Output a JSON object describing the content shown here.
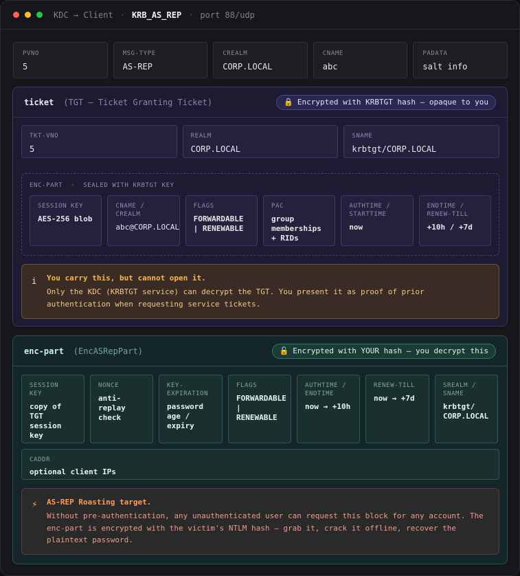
{
  "titlebar": {
    "route": "KDC → Client",
    "message": "KRB_AS_REP",
    "port": "port 88/udp"
  },
  "header_fields": [
    {
      "label": "PVNO",
      "value": "5"
    },
    {
      "label": "MSG-TYPE",
      "value": "AS-REP"
    },
    {
      "label": "CREALM",
      "value": "CORP.LOCAL"
    },
    {
      "label": "CNAME",
      "value": "abc"
    },
    {
      "label": "PADATA",
      "value": "salt info"
    }
  ],
  "ticket": {
    "title": "ticket",
    "subtitle": "(TGT — Ticket Granting Ticket)",
    "badge": "Encrypted with KRBTGT hash — opaque to you",
    "badge_icon": "lock-icon",
    "fields": [
      {
        "label": "TKT-VNO",
        "value": "5"
      },
      {
        "label": "REALM",
        "value": "CORP.LOCAL"
      },
      {
        "label": "SNAME",
        "value": "krbtgt/CORP.LOCAL"
      }
    ],
    "enc_part_label": "ENC-PART  ·  SEALED WITH KRBTGT KEY",
    "enc_fields": [
      {
        "label": "SESSION KEY",
        "value": "AES-256 blob"
      },
      {
        "label": "CNAME /\nCREALM",
        "value": "abc@CORP.LOCAL"
      },
      {
        "label": "FLAGS",
        "value": "FORWARDABLE\n| RENEWABLE"
      },
      {
        "label": "PAC",
        "value": "group\nmemberships\n+ RIDs"
      },
      {
        "label": "AUTHTIME /\nSTARTTIME",
        "value": "now"
      },
      {
        "label": "ENDTIME /\nRENEW-TILL",
        "value": "+10h / +7d"
      }
    ],
    "notice": {
      "icon": "info-icon",
      "title": "You carry this, but cannot open it.",
      "body": "Only the KDC (KRBTGT service) can decrypt the TGT. You present it as proof of prior authentication when requesting service tickets."
    }
  },
  "enc_part": {
    "title": "enc-part",
    "subtitle": "(EncASRepPart)",
    "badge": "Encrypted with YOUR hash — you decrypt this",
    "badge_icon": "unlock-icon",
    "fields": [
      {
        "label": "SESSION\nKEY",
        "value": "copy of\nTGT\nsession\nkey"
      },
      {
        "label": "NONCE",
        "value": "anti-\nreplay\ncheck"
      },
      {
        "label": "KEY-\nEXPIRATION",
        "value": "password\nage /\nexpiry"
      },
      {
        "label": "FLAGS",
        "value": "FORWARDABLE\n|\nRENEWABLE"
      },
      {
        "label": "AUTHTIME /\nENDTIME",
        "value": "now → +10h"
      },
      {
        "label": "RENEW-TILL",
        "value": "now → +7d"
      },
      {
        "label": "SREALM /\nSNAME",
        "value": "krbtgt/\nCORP.LOCAL"
      }
    ],
    "caddr": {
      "label": "CADDR",
      "value": "optional client IPs"
    },
    "notice": {
      "icon": "lightning-icon",
      "title": "AS-REP Roasting target.",
      "body": "Without pre-authentication, any unauthenticated user can request this block for any account. The enc-part is encrypted with the victim's NTLM hash — grab it, crack it offline, recover the plaintext password."
    }
  },
  "colors": {
    "ticket_accent": "#3a3763",
    "enc_accent": "#245a50",
    "warn_title": "#f5b94b",
    "danger_title": "#ff9b5a"
  }
}
